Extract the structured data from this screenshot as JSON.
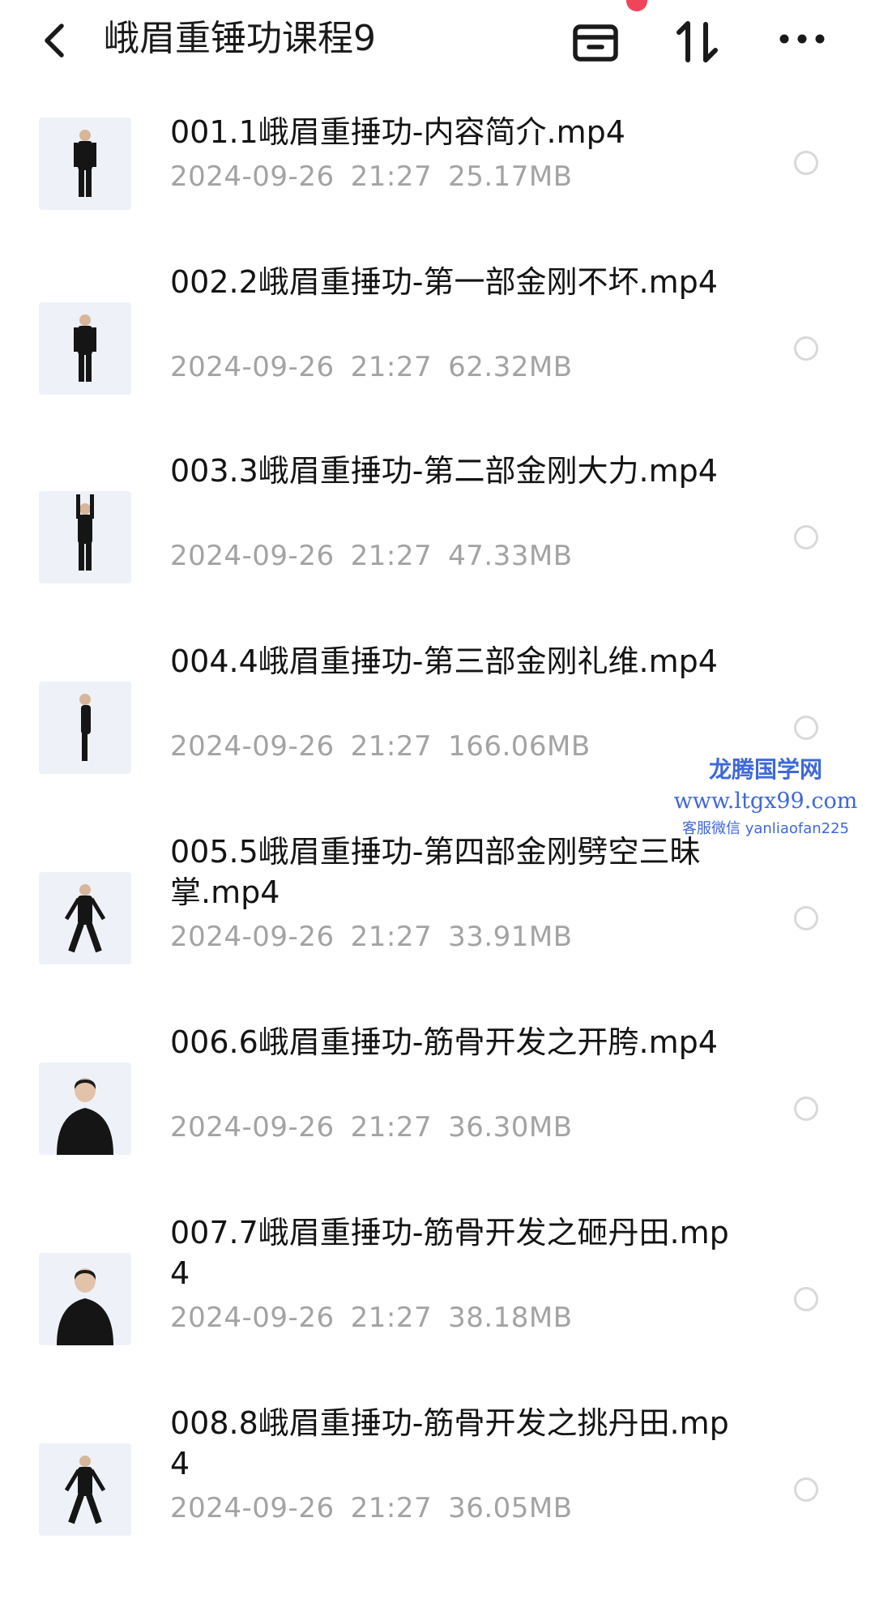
{
  "header": {
    "title": "峨眉重锤功课程9",
    "icons": [
      "back-icon",
      "archive-icon",
      "sort-icon",
      "more-icon"
    ],
    "accent_color": "#f0445a"
  },
  "files": [
    {
      "name": "001.1峨眉重捶功-内容简介.mp4",
      "date": "2024-09-26",
      "time": "21:27",
      "size": "25.17MB",
      "thumb_pose": "standing"
    },
    {
      "name": "002.2峨眉重捶功-第一部金刚不坏.mp4",
      "date": "2024-09-26",
      "time": "21:27",
      "size": "62.32MB",
      "thumb_pose": "standing"
    },
    {
      "name": "003.3峨眉重捶功-第二部金刚大力.mp4",
      "date": "2024-09-26",
      "time": "21:27",
      "size": "47.33MB",
      "thumb_pose": "arms-up"
    },
    {
      "name": "004.4峨眉重捶功-第三部金刚礼维.mp4",
      "date": "2024-09-26",
      "time": "21:27",
      "size": "166.06MB",
      "thumb_pose": "side"
    },
    {
      "name": "005.5峨眉重捶功-第四部金刚劈空三昧掌.mp4",
      "date": "2024-09-26",
      "time": "21:27",
      "size": "33.91MB",
      "thumb_pose": "wide-stance"
    },
    {
      "name": "006.6峨眉重捶功-筋骨开发之开胯.mp4",
      "date": "2024-09-26",
      "time": "21:27",
      "size": "36.30MB",
      "thumb_pose": "portrait"
    },
    {
      "name": "007.7峨眉重捶功-筋骨开发之砸丹田.mp4",
      "date": "2024-09-26",
      "time": "21:27",
      "size": "38.18MB",
      "thumb_pose": "portrait"
    },
    {
      "name": "008.8峨眉重捶功-筋骨开发之挑丹田.mp4",
      "date": "2024-09-26",
      "time": "21:27",
      "size": "36.05MB",
      "thumb_pose": "wide-stance"
    }
  ],
  "watermark": {
    "line1": "龙腾国学网",
    "line2": "www.ltgx99.com",
    "line3": "客服微信 yanliaofan225"
  }
}
